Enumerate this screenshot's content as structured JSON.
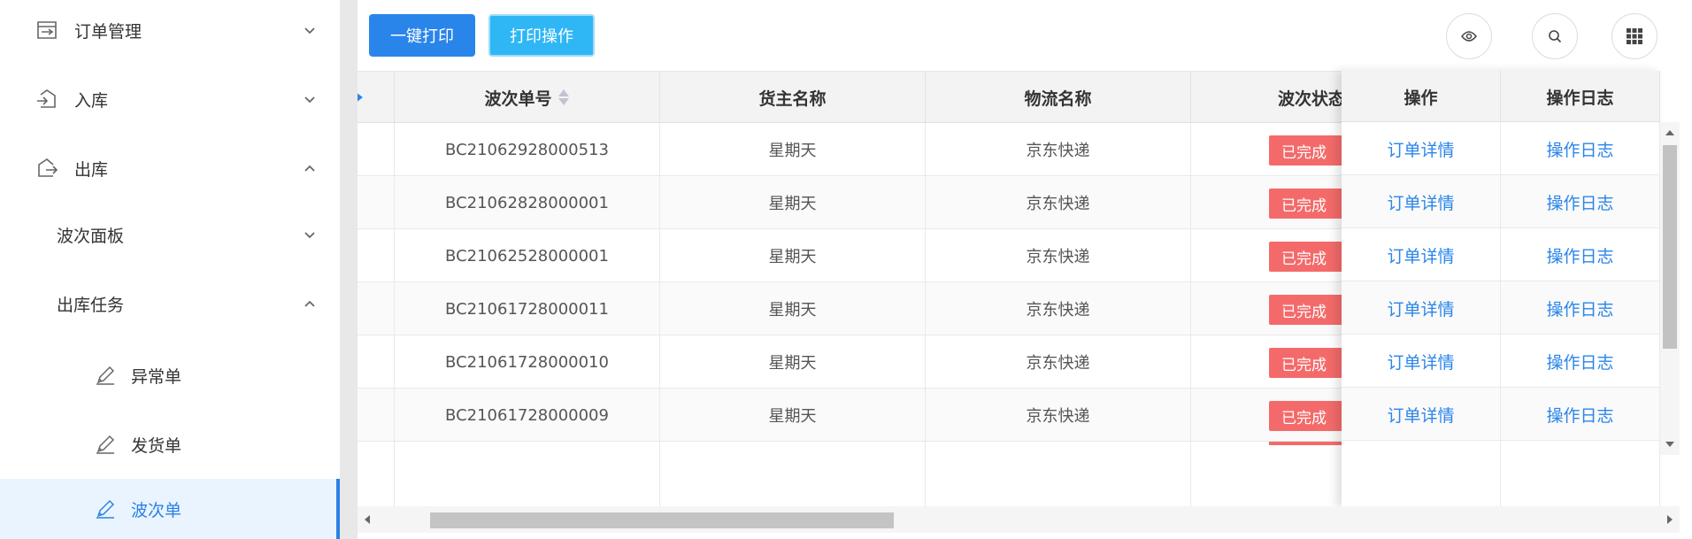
{
  "sidebar": {
    "items": [
      {
        "label": "订单管理",
        "icon": "order-box-icon",
        "chevron": "down"
      },
      {
        "label": "入库",
        "icon": "inbound-icon",
        "chevron": "down"
      },
      {
        "label": "出库",
        "icon": "outbound-icon",
        "chevron": "up"
      },
      {
        "label": "波次面板",
        "chevron": "down"
      },
      {
        "label": "出库任务",
        "chevron": "up"
      },
      {
        "label": "异常单",
        "icon": "edit-pen-icon"
      },
      {
        "label": "发货单",
        "icon": "edit-pen-icon"
      },
      {
        "label": "波次单",
        "icon": "edit-pen-icon",
        "active": true
      }
    ]
  },
  "toolbar": {
    "print_label": "一键打印",
    "op_label": "打印操作",
    "icons": [
      "eye-icon",
      "search-icon",
      "grid-icon"
    ]
  },
  "table": {
    "headers": {
      "wave_no": "波次单号",
      "owner": "货主名称",
      "logistics": "物流名称",
      "status": "波次状态",
      "action": "操作",
      "log": "操作日志"
    },
    "rows": [
      {
        "wave_no": "BC21062928000513",
        "owner": "星期天",
        "logistics": "京东快递",
        "status": "已完成",
        "action": "订单详情",
        "log": "操作日志"
      },
      {
        "wave_no": "BC21062828000001",
        "owner": "星期天",
        "logistics": "京东快递",
        "status": "已完成",
        "action": "订单详情",
        "log": "操作日志"
      },
      {
        "wave_no": "BC21062528000001",
        "owner": "星期天",
        "logistics": "京东快递",
        "status": "已完成",
        "action": "订单详情",
        "log": "操作日志"
      },
      {
        "wave_no": "BC21061728000011",
        "owner": "星期天",
        "logistics": "京东快递",
        "status": "已完成",
        "action": "订单详情",
        "log": "操作日志"
      },
      {
        "wave_no": "BC21061728000010",
        "owner": "星期天",
        "logistics": "京东快递",
        "status": "已完成",
        "action": "订单详情",
        "log": "操作日志"
      },
      {
        "wave_no": "BC21061728000009",
        "owner": "星期天",
        "logistics": "京东快递",
        "status": "已完成",
        "action": "订单详情",
        "log": "操作日志"
      }
    ]
  },
  "colors": {
    "primary": "#2a85ea",
    "secondary_button": "#2fb6f5",
    "status_done": "#f46a6a",
    "active_menu_bg": "#eaf4ff"
  }
}
